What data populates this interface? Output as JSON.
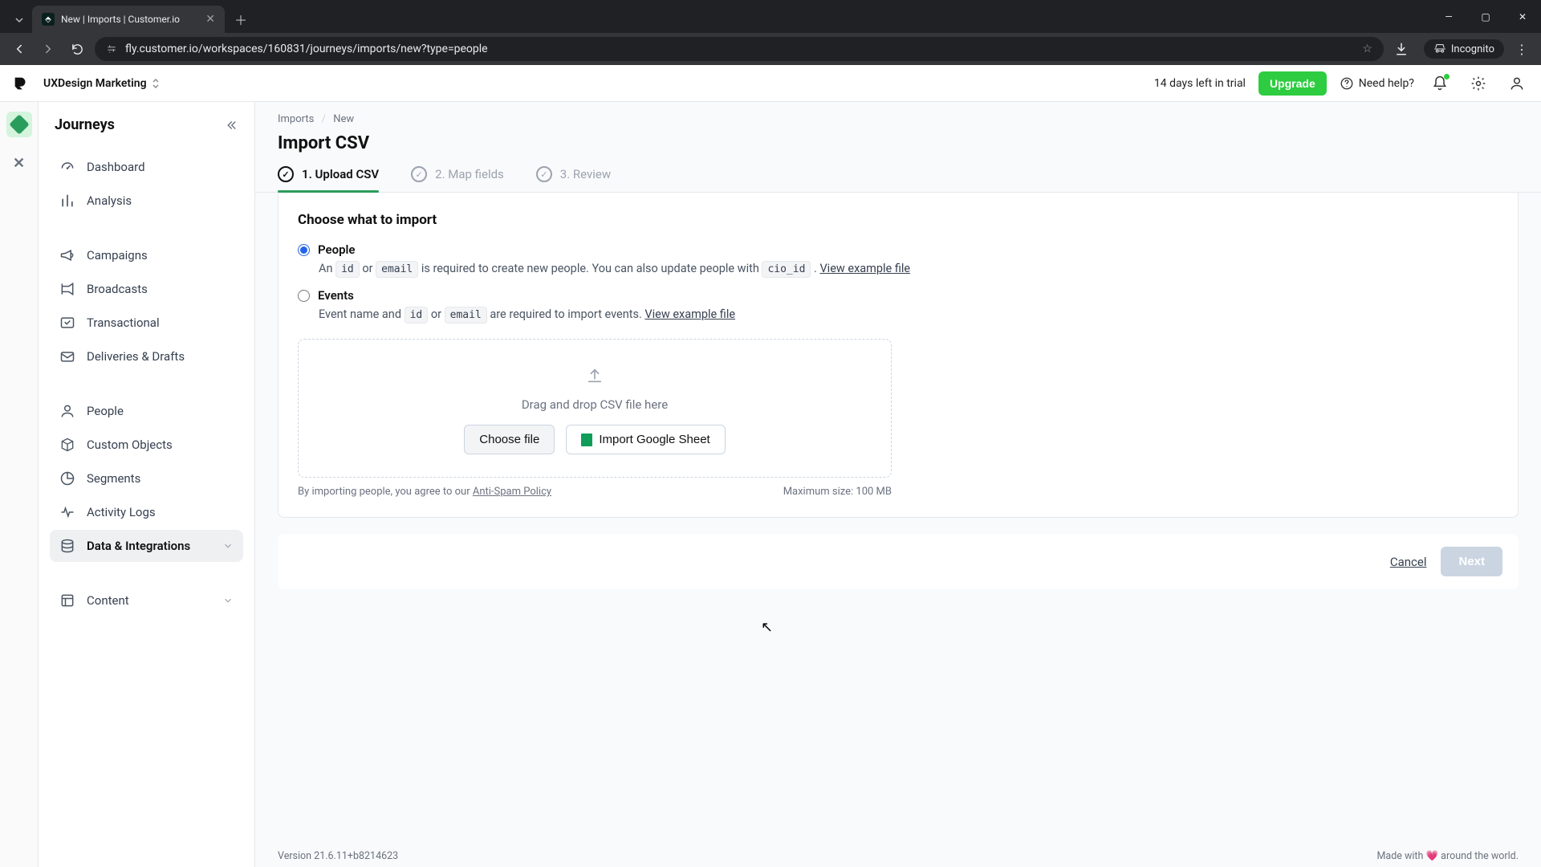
{
  "browser": {
    "tab_title": "New | Imports | Customer.io",
    "url": "fly.customer.io/workspaces/160831/journeys/imports/new?type=people",
    "incognito": "Incognito"
  },
  "header": {
    "workspace": "UXDesign Marketing",
    "trial": "14 days left in trial",
    "upgrade": "Upgrade",
    "help": "Need help?"
  },
  "sidebar": {
    "title": "Journeys",
    "items": {
      "dashboard": "Dashboard",
      "analysis": "Analysis",
      "campaigns": "Campaigns",
      "broadcasts": "Broadcasts",
      "transactional": "Transactional",
      "deliveries": "Deliveries & Drafts",
      "people": "People",
      "custom_objects": "Custom Objects",
      "segments": "Segments",
      "activity_logs": "Activity Logs",
      "data_integrations": "Data & Integrations",
      "content": "Content"
    }
  },
  "breadcrumb": {
    "parent": "Imports",
    "current": "New"
  },
  "page": {
    "title": "Import CSV",
    "steps": {
      "s1": "1. Upload CSV",
      "s2": "2. Map fields",
      "s3": "3. Review"
    },
    "section_title": "Choose what to import",
    "people": {
      "label": "People",
      "desc_1": "An ",
      "code_id": "id",
      "desc_or": " or ",
      "code_email": "email",
      "desc_2": " is required to create new people. You can also update people with ",
      "code_cio": "cio_id",
      "desc_3": " . ",
      "link": "View example file"
    },
    "events": {
      "label": "Events",
      "desc_1": "Event name and ",
      "code_id": "id",
      "desc_or": " or ",
      "code_email": "email",
      "desc_2": " are required to import events. ",
      "link": "View example file"
    },
    "dropzone": {
      "text": "Drag and drop CSV file here",
      "choose": "Choose file",
      "gsheet": "Import Google Sheet"
    },
    "policy_prefix": "By importing people, you agree to our ",
    "policy_link": "Anti-Spam Policy",
    "max_size": "Maximum size: 100 MB",
    "cancel": "Cancel",
    "next": "Next"
  },
  "footer": {
    "version": "Version 21.6.11+b8214623",
    "made_prefix": "Made with ",
    "made_suffix": " around the world."
  }
}
